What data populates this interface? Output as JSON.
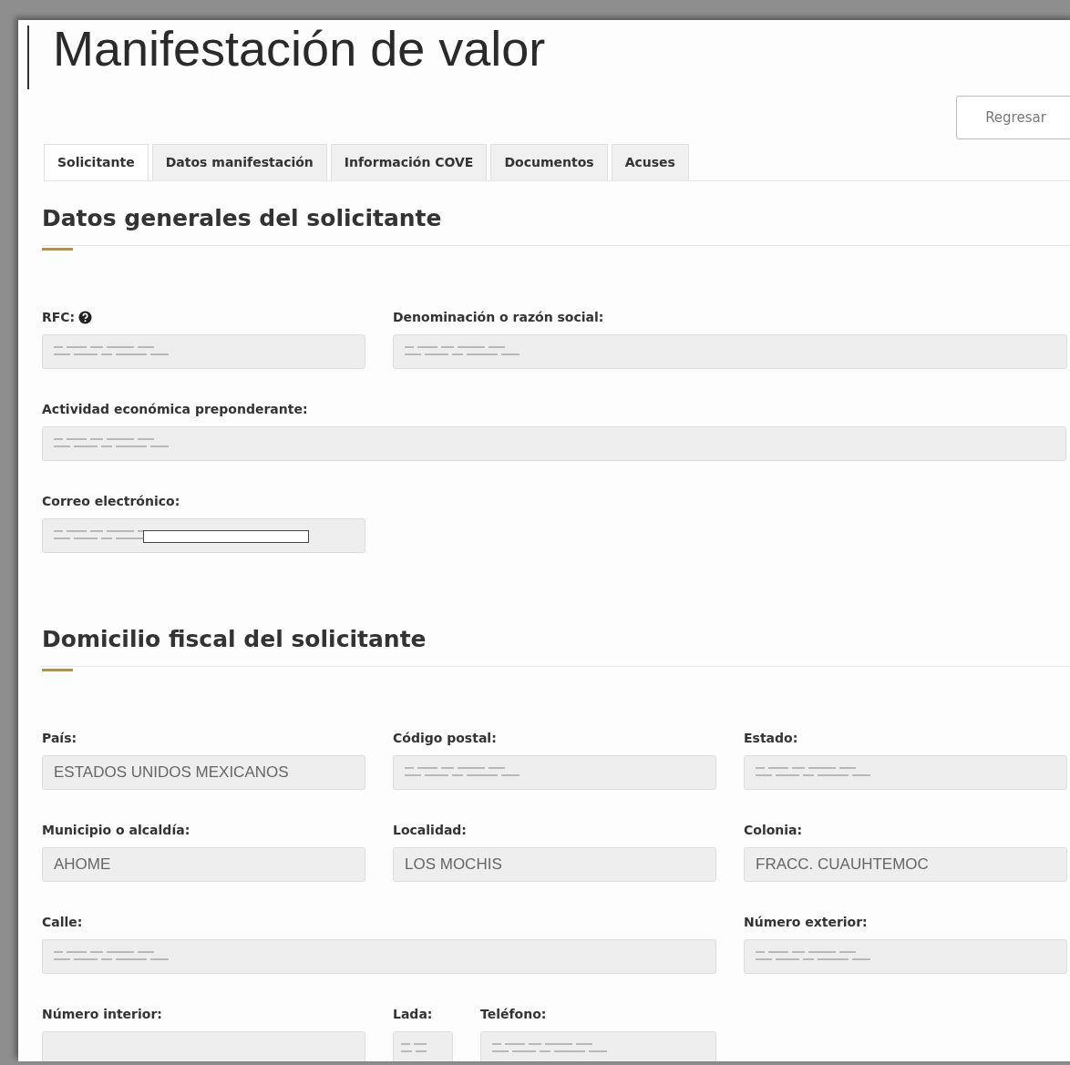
{
  "title": "Manifestación de valor",
  "back_button": "Regresar",
  "tabs": [
    {
      "label": "Solicitante",
      "selected": true
    },
    {
      "label": "Datos manifestación",
      "selected": false
    },
    {
      "label": "Información COVE",
      "selected": false
    },
    {
      "label": "Documentos",
      "selected": false
    },
    {
      "label": "Acuses",
      "selected": false
    }
  ],
  "sections": [
    {
      "title": "Datos generales del solicitante",
      "rows": [
        [
          {
            "label": "RFC:",
            "kind": "third",
            "help": true,
            "redacted": true
          },
          {
            "label": "Denominación o razón social:",
            "kind": "two_thirds",
            "redacted": true
          }
        ],
        [
          {
            "label": "Actividad económica preponderante:",
            "kind": "full",
            "redacted": true
          }
        ],
        [
          {
            "label": "Correo electrónico:",
            "kind": "third",
            "redacted": true,
            "boxed": true
          }
        ]
      ]
    },
    {
      "title": "Domicilio fiscal del solicitante",
      "rows": [
        [
          {
            "label": "País:",
            "kind": "third",
            "value": "ESTADOS UNIDOS MEXICANOS"
          },
          {
            "label": "Código postal:",
            "kind": "third",
            "redacted": true
          },
          {
            "label": "Estado:",
            "kind": "third",
            "redacted": true
          }
        ],
        [
          {
            "label": "Municipio o alcaldía:",
            "kind": "third",
            "value": "AHOME"
          },
          {
            "label": "Localidad:",
            "kind": "third",
            "value": "LOS MOCHIS"
          },
          {
            "label": "Colonia:",
            "kind": "third",
            "value": "FRACC. CUAUHTEMOC"
          }
        ],
        [
          {
            "label": "Calle:",
            "kind": "two_thirds",
            "redacted": true
          },
          "",
          {
            "label": "Número exterior:",
            "kind": "third",
            "redacted": true
          }
        ],
        [
          {
            "label": "Número interior:",
            "kind": "third"
          },
          {
            "label": "Lada:",
            "kind": "short",
            "redacted": true
          },
          {
            "label": "Teléfono:",
            "kind": "rest",
            "redacted": true
          }
        ]
      ]
    }
  ]
}
